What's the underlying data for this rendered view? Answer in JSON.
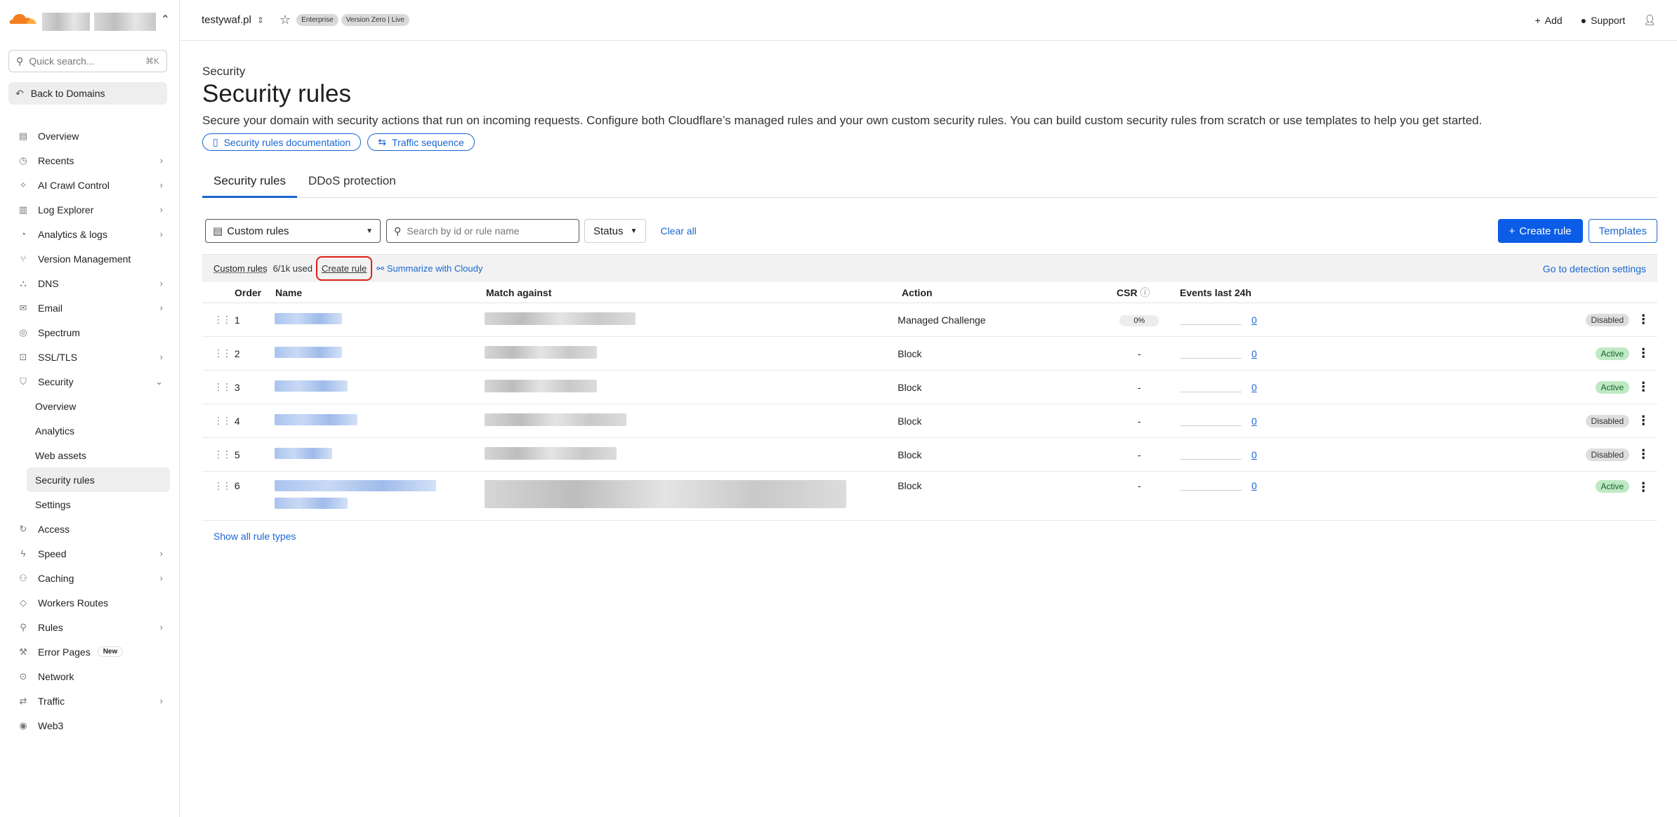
{
  "sidebar": {
    "quick_search_placeholder": "Quick search...",
    "quick_search_shortcut": "⌘K",
    "back_label": "Back to Domains",
    "items": [
      {
        "label": "Overview",
        "icon": "document-icon",
        "chevron": false
      },
      {
        "label": "Recents",
        "icon": "clock-icon",
        "chevron": true
      },
      {
        "label": "AI Crawl Control",
        "icon": "ai-icon",
        "chevron": true
      },
      {
        "label": "Log Explorer",
        "icon": "log-icon",
        "chevron": true
      },
      {
        "label": "Analytics & logs",
        "icon": "chart-icon",
        "chevron": true
      },
      {
        "label": "Version Management",
        "icon": "branch-icon",
        "chevron": false
      },
      {
        "label": "DNS",
        "icon": "dns-icon",
        "chevron": true
      },
      {
        "label": "Email",
        "icon": "mail-icon",
        "chevron": true
      },
      {
        "label": "Spectrum",
        "icon": "spectrum-icon",
        "chevron": false
      },
      {
        "label": "SSL/TLS",
        "icon": "lock-icon",
        "chevron": true
      },
      {
        "label": "Security",
        "icon": "shield-icon",
        "chevron": "open"
      }
    ],
    "security_sub": [
      "Overview",
      "Analytics",
      "Web assets",
      "Security rules",
      "Settings"
    ],
    "items_after": [
      {
        "label": "Access",
        "icon": "access-icon",
        "chevron": false
      },
      {
        "label": "Speed",
        "icon": "bolt-icon",
        "chevron": true
      },
      {
        "label": "Caching",
        "icon": "cache-icon",
        "chevron": true
      },
      {
        "label": "Workers Routes",
        "icon": "workers-icon",
        "chevron": false
      },
      {
        "label": "Rules",
        "icon": "rules-icon",
        "chevron": true
      },
      {
        "label": "Error Pages",
        "icon": "wrench-icon",
        "chevron": false,
        "badge": "New"
      },
      {
        "label": "Network",
        "icon": "pin-icon",
        "chevron": false
      },
      {
        "label": "Traffic",
        "icon": "traffic-icon",
        "chevron": true
      },
      {
        "label": "Web3",
        "icon": "web3-icon",
        "chevron": false
      }
    ]
  },
  "topbar": {
    "domain": "testywaf.pl",
    "plan_badge": "Enterprise",
    "version_badge": "Version Zero | Live",
    "add_label": "Add",
    "support_label": "Support"
  },
  "page": {
    "breadcrumb": "Security",
    "title": "Security rules",
    "description": "Secure your domain with security actions that run on incoming requests. Configure both Cloudflare’s managed rules and your own custom security rules. You can build custom security rules from scratch or use templates to help you get started.",
    "doc_link": "Security rules documentation",
    "traffic_link": "Traffic sequence",
    "tabs": [
      "Security rules",
      "DDoS protection"
    ]
  },
  "filters": {
    "rule_type": "Custom rules",
    "search_placeholder": "Search by id or rule name",
    "status_label": "Status",
    "clear_all": "Clear all",
    "create_rule": "Create rule",
    "templates": "Templates"
  },
  "infobar": {
    "custom_rules": "Custom rules",
    "usage": "6/1k used",
    "create_rule": "Create rule",
    "summarize": "Summarize with Cloudy",
    "detection_settings": "Go to detection settings"
  },
  "table": {
    "columns": [
      "Order",
      "Name",
      "Match against",
      "Action",
      "CSR",
      "Events last 24h"
    ],
    "rows": [
      {
        "order": "1",
        "action": "Managed Challenge",
        "csr": "0%",
        "events": "0",
        "status": "Disabled"
      },
      {
        "order": "2",
        "action": "Block",
        "csr": "-",
        "events": "0",
        "status": "Active"
      },
      {
        "order": "3",
        "action": "Block",
        "csr": "-",
        "events": "0",
        "status": "Active"
      },
      {
        "order": "4",
        "action": "Block",
        "csr": "-",
        "events": "0",
        "status": "Disabled"
      },
      {
        "order": "5",
        "action": "Block",
        "csr": "-",
        "events": "0",
        "status": "Disabled"
      },
      {
        "order": "6",
        "action": "Block",
        "csr": "-",
        "events": "0",
        "status": "Active"
      }
    ]
  },
  "show_all": "Show all rule types",
  "colors": {
    "accent": "#0b5ce6",
    "link": "#1a67d2",
    "highlight": "#e0201b",
    "active_bg": "#bfe9c4"
  }
}
